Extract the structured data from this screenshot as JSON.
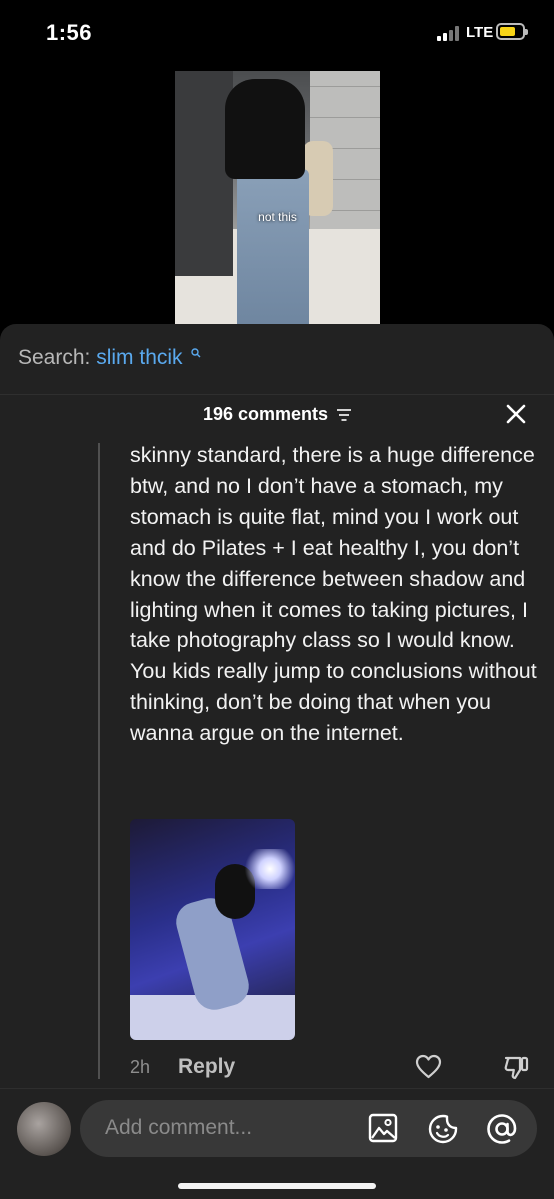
{
  "status_bar": {
    "time": "1:56",
    "network": "LTE",
    "battery_level": 0.55,
    "battery_color": "#f7d417"
  },
  "video": {
    "caption": "not this"
  },
  "search": {
    "prefix": "Search:",
    "query": "slim thcik",
    "query_color": "#5aa9ee",
    "icon": "search-icon"
  },
  "comments": {
    "count_label": "196 comments",
    "filter_icon": "filter-icon",
    "close_icon": "close-icon"
  },
  "comment": {
    "text": "skinny standard, there is a huge difference btw, and no I don’t have a stomach, my stomach is quite flat, mind you I work out and do Pilates + I eat healthy I, you don’t know the difference between shadow and lighting when it comes to taking pictures, I take photography class so I would know. You kids really jump to conclusions without thinking, don’t be doing that when you wanna argue on the internet.",
    "time": "2h",
    "reply_label": "Reply",
    "like_icon": "heart-icon",
    "dislike_icon": "dislike-icon"
  },
  "composer": {
    "placeholder": "Add comment...",
    "icons": [
      "image-icon",
      "emoji-icon",
      "at-mention-icon"
    ]
  }
}
